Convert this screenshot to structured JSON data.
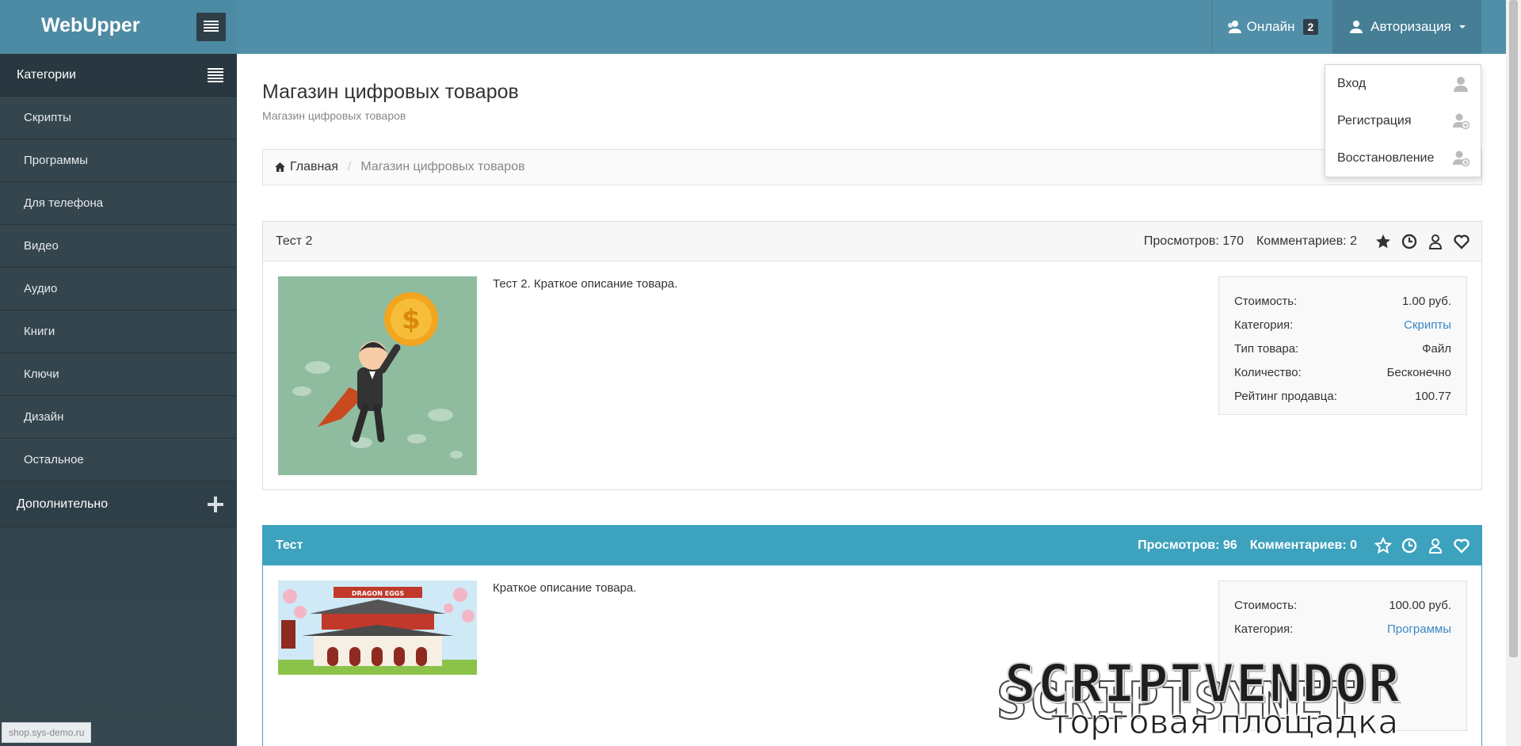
{
  "header": {
    "brand": "WebUpper",
    "online_label": "Онлайн",
    "online_count": "2",
    "auth_label": "Авторизация"
  },
  "auth_menu": {
    "items": [
      {
        "label": "Вход",
        "icon": "user-icon"
      },
      {
        "label": "Регистрация",
        "icon": "user-add-icon"
      },
      {
        "label": "Восстановление",
        "icon": "user-remove-icon"
      }
    ]
  },
  "sidebar": {
    "heading": "Категории",
    "items": [
      {
        "label": "Скрипты"
      },
      {
        "label": "Программы"
      },
      {
        "label": "Для телефона"
      },
      {
        "label": "Видео"
      },
      {
        "label": "Аудио"
      },
      {
        "label": "Книги"
      },
      {
        "label": "Ключи"
      },
      {
        "label": "Дизайн"
      },
      {
        "label": "Остальное"
      }
    ],
    "extra": "Дополнительно",
    "status_url": "shop.sys-demo.ru"
  },
  "page": {
    "title": "Магазин цифровых товаров",
    "subtitle": "Магазин цифровых товаров"
  },
  "breadcrumb": {
    "home": "Главная",
    "current": "Магазин цифровых товаров"
  },
  "products": [
    {
      "title": "Тест 2",
      "views": "Просмотров: 170",
      "comments": "Комментариев: 2",
      "description": "Тест 2. Краткое описание товара.",
      "info": [
        {
          "label": "Стоимость:",
          "value": "1.00 руб."
        },
        {
          "label": "Категория:",
          "value": "Скрипты"
        },
        {
          "label": "Тип товара:",
          "value": "Файл"
        },
        {
          "label": "Количество:",
          "value": "Бесконечно"
        },
        {
          "label": "Рейтинг продавца:",
          "value": "100.77"
        }
      ]
    },
    {
      "title": "Тест",
      "views": "Просмотров: 96",
      "comments": "Комментариев: 0",
      "description": "Краткое описание товара.",
      "info": [
        {
          "label": "Стоимость:",
          "value": "100.00 руб."
        },
        {
          "label": "Категория:",
          "value": "Программы"
        }
      ]
    }
  ],
  "watermark": {
    "main": "SCRIPTVENDOR",
    "ghost": "SCRIPTSYNET",
    "sub": "торговая площадка"
  },
  "colors": {
    "topbar": "#518fa8",
    "sidebar": "#2f3f48",
    "accent": "#3da2bd",
    "link": "#3a88c6"
  }
}
